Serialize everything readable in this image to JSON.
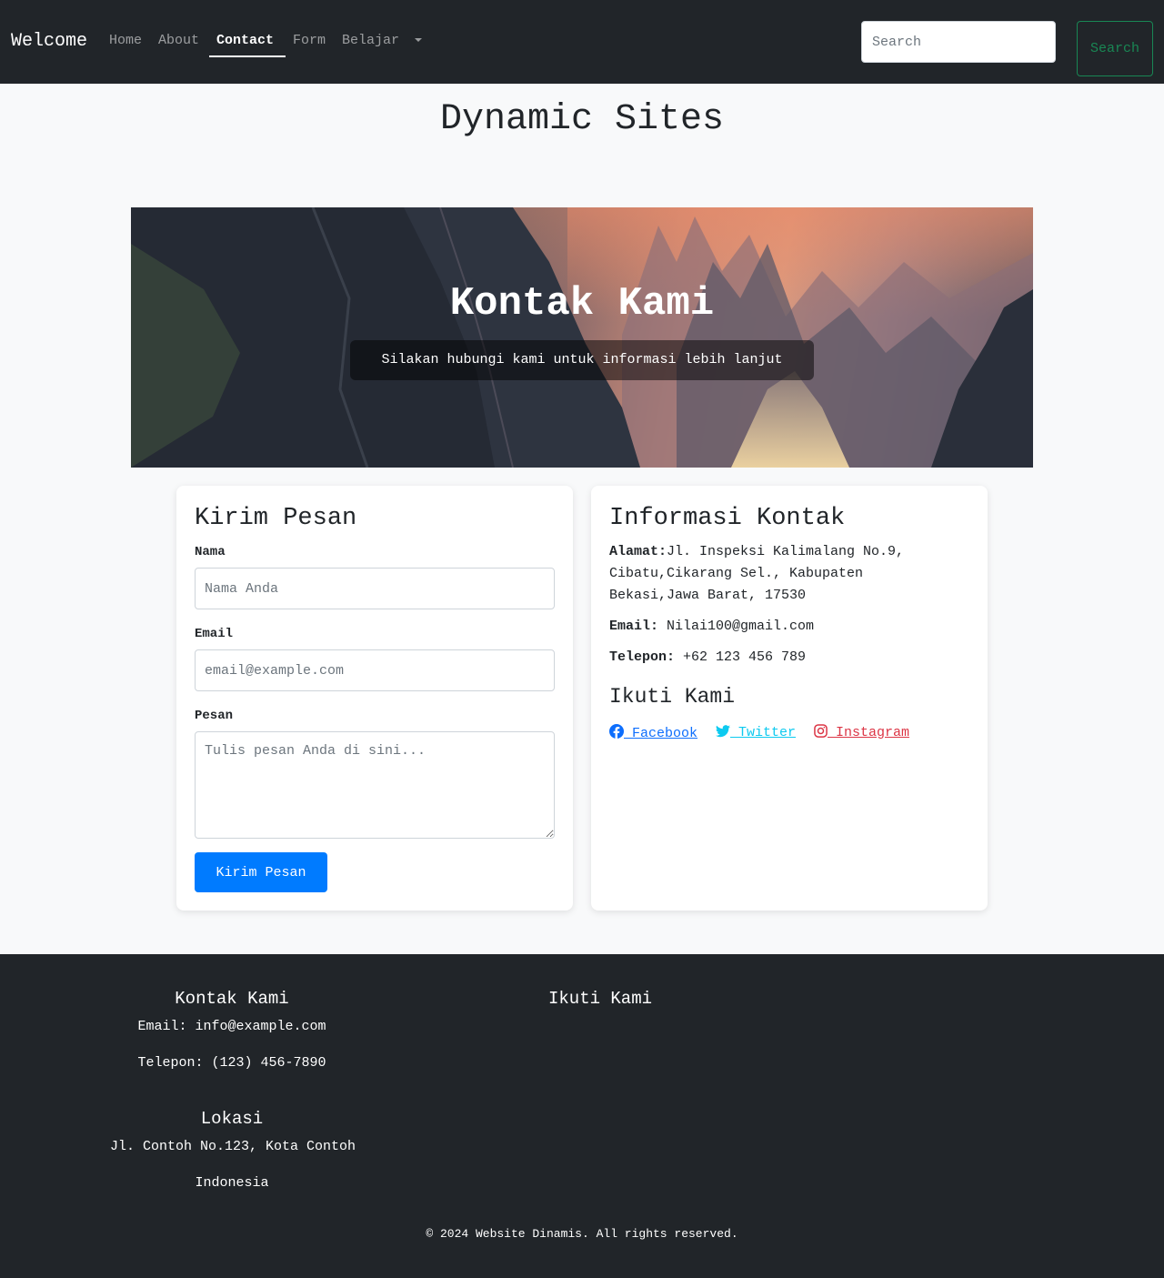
{
  "navbar": {
    "brand": "Welcome",
    "items": [
      {
        "label": "Home"
      },
      {
        "label": "About"
      },
      {
        "label": "Contact"
      },
      {
        "label": "Form"
      },
      {
        "label": "Belajar"
      }
    ],
    "search_placeholder": "Search",
    "search_button": "Search"
  },
  "page_title": "Dynamic Sites",
  "hero": {
    "title": "Kontak Kami",
    "subtitle": "Silakan hubungi kami untuk informasi lebih lanjut"
  },
  "form_card": {
    "heading": "Kirim Pesan",
    "name_label": "Nama",
    "name_placeholder": "Nama Anda",
    "email_label": "Email",
    "email_placeholder": "email@example.com",
    "message_label": "Pesan",
    "message_placeholder": "Tulis pesan Anda di sini...",
    "submit_label": "Kirim Pesan"
  },
  "info_card": {
    "heading": "Informasi Kontak",
    "address_label": "Alamat:",
    "address_value": "Jl. Inspeksi Kalimalang No.9, Cibatu,Cikarang Sel., Kabupaten Bekasi,Jawa Barat, 17530",
    "email_label": "Email:",
    "email_value": " Nilai100@gmail.com",
    "phone_label": "Telepon:",
    "phone_value": " +62 123 456 789",
    "follow_heading": "Ikuti Kami",
    "social": [
      {
        "label": " Facebook",
        "icon": "facebook-icon",
        "color": "#0d6efd"
      },
      {
        "label": " Twitter",
        "icon": "twitter-icon",
        "color": "#0dcaf0"
      },
      {
        "label": " Instagram",
        "icon": "instagram-icon",
        "color": "#dc3545"
      }
    ]
  },
  "footer": {
    "contact_heading": "Kontak Kami",
    "email_text": "Email: info@example.com",
    "phone_text": "Telepon: (123) 456-7890",
    "location_heading": "Lokasi",
    "address_line": "Jl. Contoh No.123, Kota Contoh",
    "country": "Indonesia",
    "follow_heading": "Ikuti Kami",
    "copyright": "© 2024 Website Dinamis. All rights reserved."
  }
}
